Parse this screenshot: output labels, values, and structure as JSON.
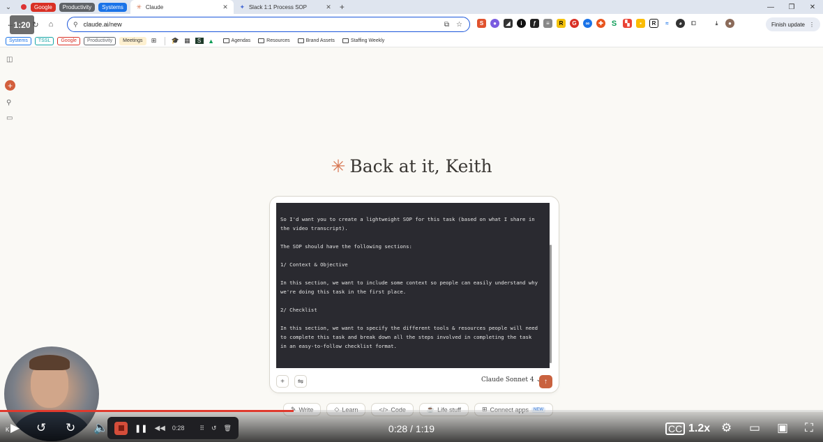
{
  "browser": {
    "tab_groups": [
      {
        "label": "Google",
        "color": "#d93025"
      },
      {
        "label": "Productivity",
        "color": "#5f6368"
      },
      {
        "label": "Systems",
        "color": "#1a73e8"
      }
    ],
    "tabs": [
      {
        "label": "Claude",
        "active": true
      },
      {
        "label": "Slack 1:1 Process SOP",
        "active": false
      }
    ],
    "url": "claude.ai/new",
    "finish_update": "Finish update",
    "bookmark_chips": [
      {
        "label": "Systems",
        "color": "#1a73e8"
      },
      {
        "label": "TSSL",
        "color": "#12a4a4"
      },
      {
        "label": "Google",
        "color": "#d93025"
      },
      {
        "label": "Productivity",
        "color": "#5f6368"
      },
      {
        "label": "Meetings",
        "color": "#e8a317"
      }
    ],
    "bookmark_folders": [
      "Agendas",
      "Resources",
      "Brand Assets",
      "Staffing Weekly"
    ]
  },
  "claude": {
    "greeting": "Back at it, Keith",
    "prompt_text": "So I'd want you to create a lightweight SOP for this task (based on what I share in\nthe video transcript).\n\nThe SOP should have the following sections:\n\n1/ Context & Objective\n\nIn this section, we want to include some context so people can easily understand why\nwe're doing this task in the first place.\n\n2/ Checklist\n\nIn this section, we want to specify the different tools & resources people will need\nto complete this task and break down all the steps involved in completing the task\nin an easy-to-follow checklist format.",
    "model": "Claude Sonnet 4",
    "chips": [
      "Write",
      "Learn",
      "Code",
      "Life stuff",
      "Connect apps"
    ],
    "new_badge": "NEW"
  },
  "video": {
    "time": "0:28 / 1:19",
    "recorder_time": "0:28",
    "speed": "1.2x",
    "rewind_badge": "1:20",
    "progress": 0.357,
    "progress_color": "#e03a2e"
  }
}
